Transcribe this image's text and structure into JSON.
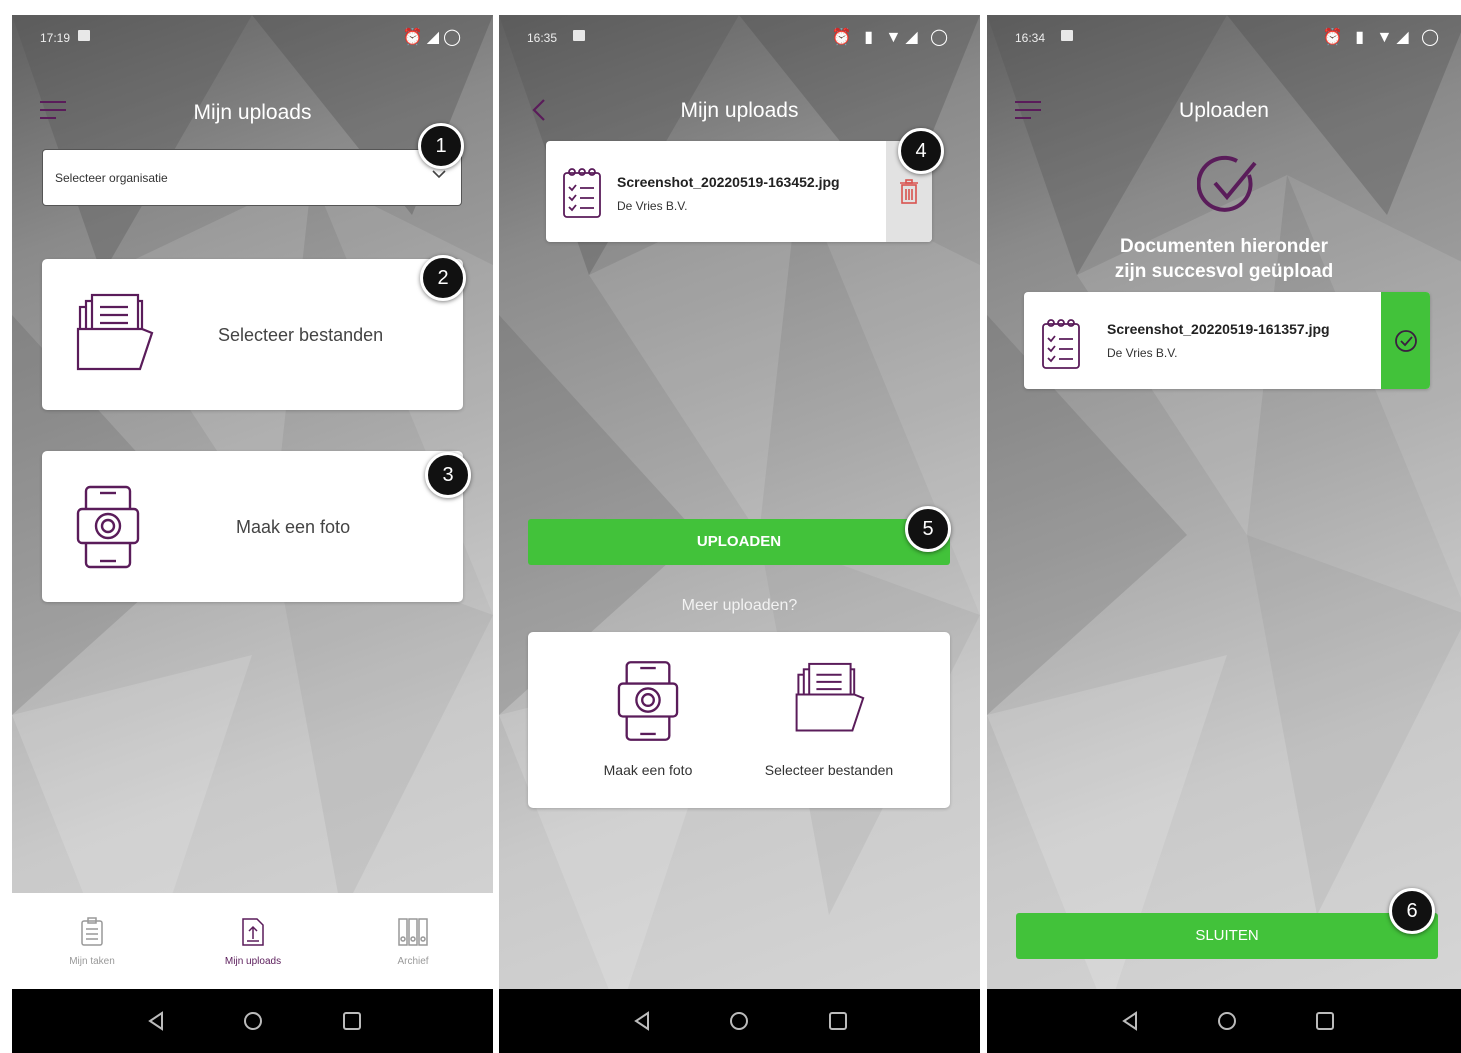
{
  "screens": [
    {
      "status": {
        "time": "17:19",
        "icons": [
          "alarm-icon",
          "signal-icon",
          "loading-icon"
        ]
      },
      "header": {
        "title": "Mijn uploads",
        "menu_icon": "hamburger-icon"
      },
      "organisation_select": {
        "placeholder": "Selecteer organisatie"
      },
      "actions": [
        {
          "label": "Selecteer bestanden",
          "icon": "folder-files-icon",
          "badge": "2"
        },
        {
          "label": "Maak een foto",
          "icon": "camera-phone-icon",
          "badge": "3"
        }
      ],
      "select_badge": "1",
      "tabs": [
        {
          "label": "Mijn taken",
          "icon": "checklist-icon"
        },
        {
          "label": "Mijn uploads",
          "icon": "upload-file-icon",
          "active": true
        },
        {
          "label": "Archief",
          "icon": "archive-binders-icon"
        }
      ]
    },
    {
      "status": {
        "time": "16:35"
      },
      "header": {
        "title": "Mijn uploads",
        "back_icon": "chevron-left-icon"
      },
      "file": {
        "name": "Screenshot_20220519-163452.jpg",
        "organisation": "De Vries B.V.",
        "badge": "4"
      },
      "upload_button": {
        "label": "UPLOADEN",
        "badge": "5"
      },
      "more_prompt": "Meer uploaden?",
      "more_actions": [
        {
          "label": "Maak een foto",
          "icon": "camera-phone-icon"
        },
        {
          "label": "Selecteer bestanden",
          "icon": "folder-files-icon"
        }
      ]
    },
    {
      "status": {
        "time": "16:34"
      },
      "header": {
        "title": "Uploaden",
        "menu_icon": "hamburger-icon"
      },
      "success": {
        "line1": "Documenten hieronder",
        "line2": "zijn succesvol geüpload"
      },
      "file": {
        "name": "Screenshot_20220519-161357.jpg",
        "organisation": "De Vries B.V."
      },
      "close_button": {
        "label": "SLUITEN",
        "badge": "6"
      }
    }
  ],
  "colors": {
    "brand_purple": "#5a1c5a",
    "green": "#42c23a",
    "delete_red": "#d9534f"
  }
}
